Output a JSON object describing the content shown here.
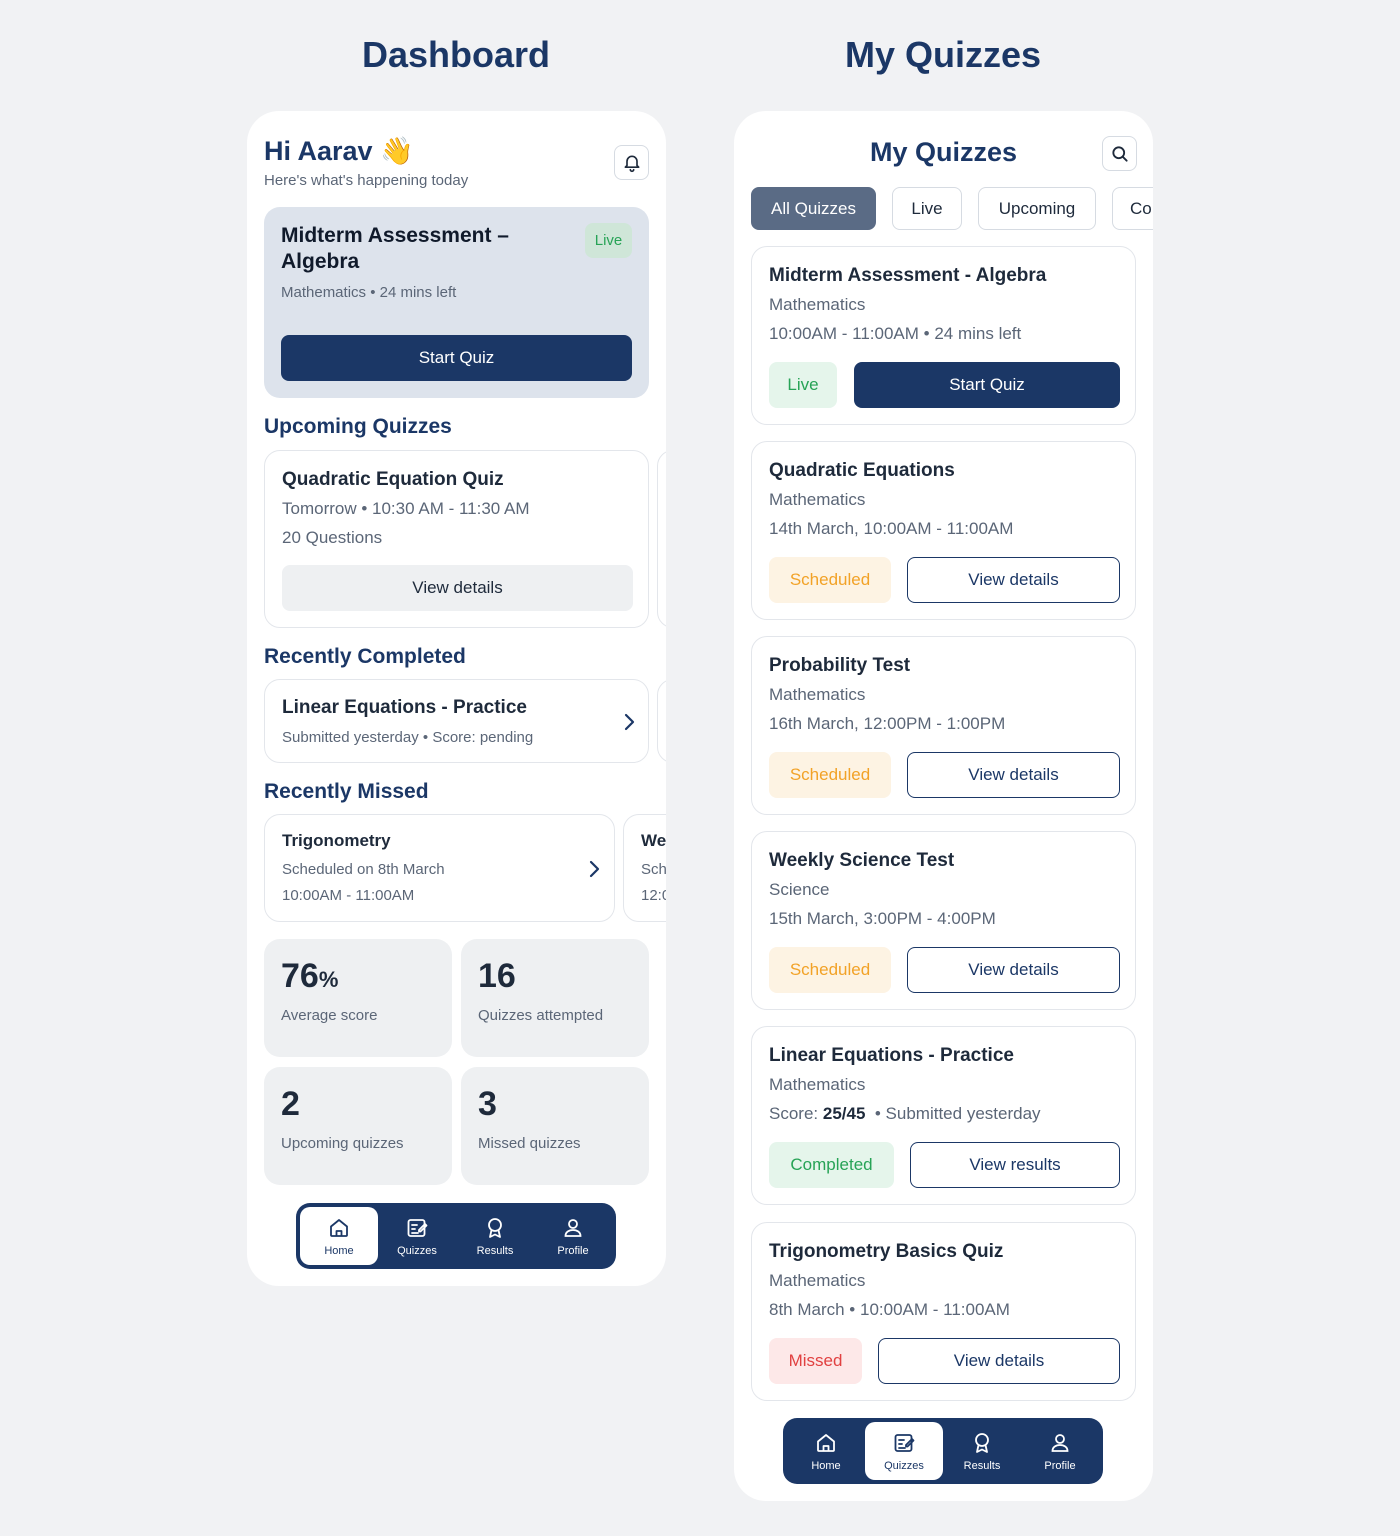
{
  "headings": {
    "left": "Dashboard",
    "right": "My Quizzes"
  },
  "dashboard": {
    "greeting": "Hi Aarav 👋",
    "subtitle": "Here's what's happening today",
    "live_card": {
      "title": "Midterm Assessment – Algebra",
      "meta": "Mathematics • 24 mins left",
      "badge": "Live",
      "button": "Start Quiz"
    },
    "upcoming": {
      "heading": "Upcoming Quizzes",
      "card": {
        "title": "Quadratic Equation Quiz",
        "line1": "Tomorrow • 10:30 AM - 11:30 AM",
        "line2": "20 Questions",
        "button": "View details"
      }
    },
    "completed": {
      "heading": "Recently Completed",
      "card": {
        "title": "Linear Equations - Practice",
        "line1": "Submitted yesterday • Score: pending"
      }
    },
    "missed": {
      "heading": "Recently Missed",
      "card": {
        "title": "Trigonometry",
        "line1": "Scheduled on 8th March",
        "line2": "10:00AM - 11:00AM"
      },
      "peek": {
        "title": "We",
        "line1": "Sch",
        "line2": "12:0"
      }
    },
    "stats": [
      {
        "value": "76",
        "unit": "%",
        "label": "Average score"
      },
      {
        "value": "16",
        "unit": "",
        "label": "Quizzes attempted"
      },
      {
        "value": "2",
        "unit": "",
        "label": "Upcoming quizzes"
      },
      {
        "value": "3",
        "unit": "",
        "label": "Missed quizzes"
      }
    ]
  },
  "nav": {
    "home": "Home",
    "quizzes": "Quizzes",
    "results": "Results",
    "profile": "Profile"
  },
  "my_quizzes": {
    "title": "My Quizzes",
    "filters": [
      "All Quizzes",
      "Live",
      "Upcoming",
      "Co"
    ],
    "active_filter": "All Quizzes",
    "items": [
      {
        "title": "Midterm Assessment - Algebra",
        "subject": "Mathematics",
        "time": "10:00AM - 11:00AM • 24 mins left",
        "status": "Live",
        "action": "Start Quiz"
      },
      {
        "title": "Quadratic Equations",
        "subject": "Mathematics",
        "time": "14th March, 10:00AM - 11:00AM",
        "status": "Scheduled",
        "action": "View details"
      },
      {
        "title": "Probability Test",
        "subject": "Mathematics",
        "time": "16th March, 12:00PM - 1:00PM",
        "status": "Scheduled",
        "action": "View details"
      },
      {
        "title": "Weekly Science Test",
        "subject": "Science",
        "time": "15th March, 3:00PM - 4:00PM",
        "status": "Scheduled",
        "action": "View details"
      },
      {
        "title": "Linear Equations - Practice",
        "subject": "Mathematics",
        "score_label": "Score:",
        "score": "25/45",
        "time": "• Submitted yesterday",
        "status": "Completed",
        "action": "View results"
      },
      {
        "title": "Trigonometry Basics Quiz",
        "subject": "Mathematics",
        "time": "8th March • 10:00AM - 11:00AM",
        "status": "Missed",
        "action": "View details"
      }
    ]
  },
  "colors": {
    "primary": "#1b3766",
    "live": "#27a356",
    "scheduled": "#f2a227",
    "missed": "#e14141",
    "chip_active": "#5a6b85"
  }
}
